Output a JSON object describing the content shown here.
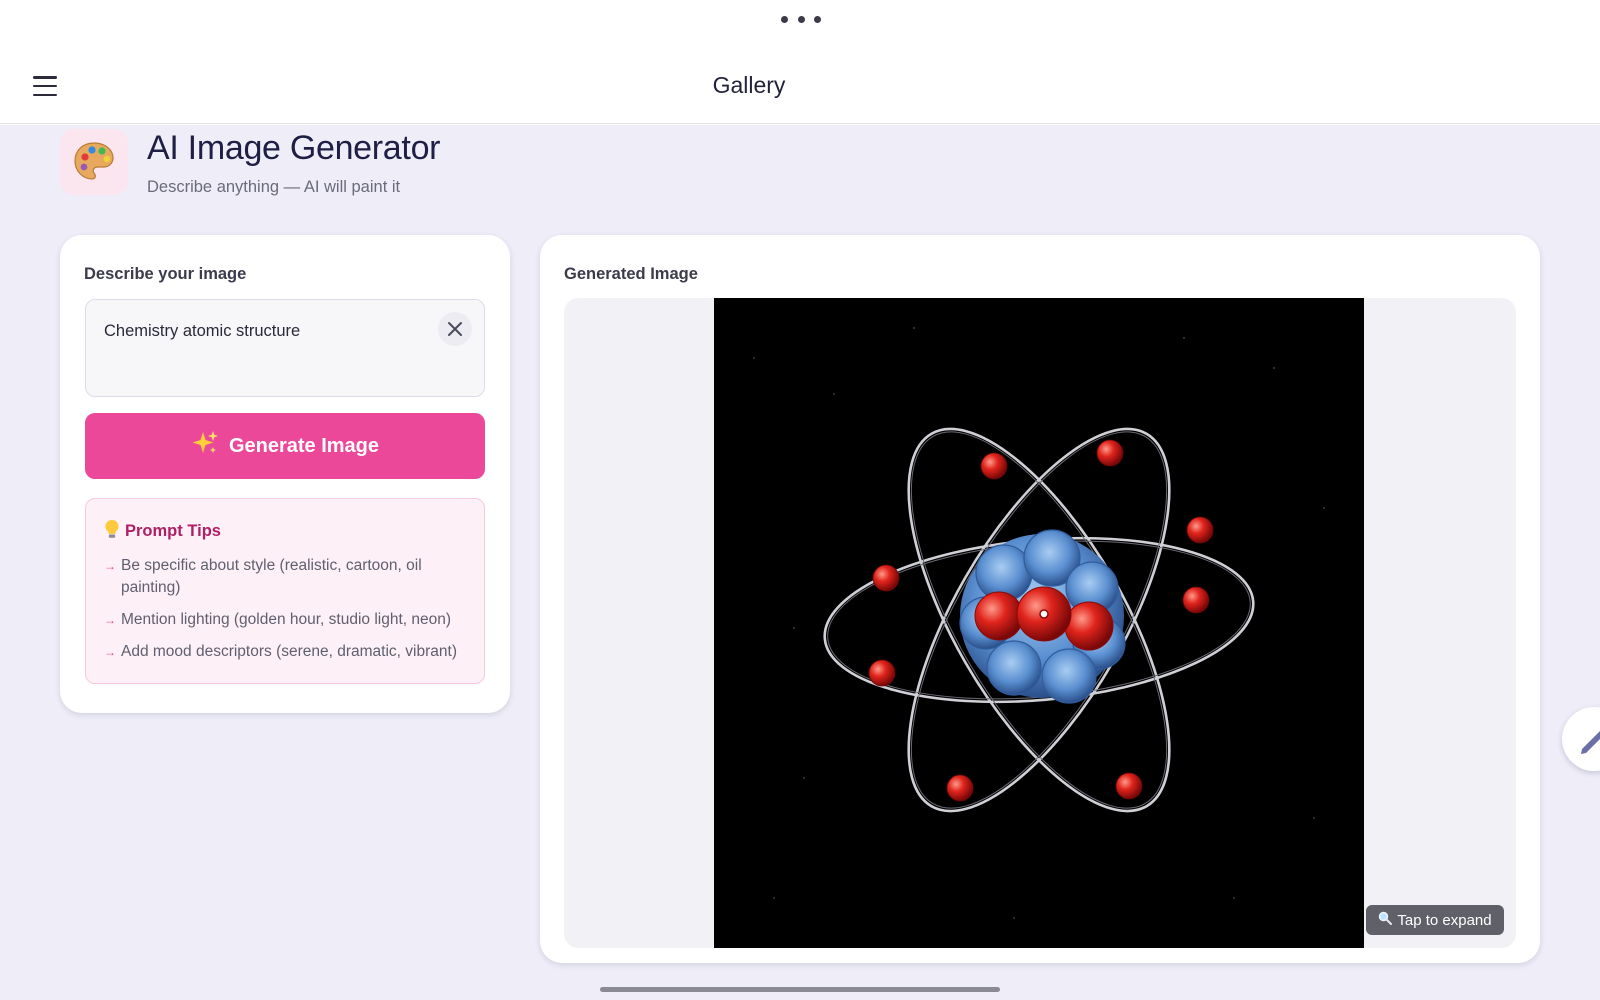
{
  "header": {
    "title": "Gallery",
    "menu_icon": "hamburger-menu-icon",
    "more_icon": "more-dots-icon"
  },
  "page": {
    "icon": "palette-icon",
    "title": "AI Image Generator",
    "subtitle": "Describe anything — AI will paint it"
  },
  "prompt_panel": {
    "label": "Describe your image",
    "prompt_value": "Chemistry atomic structure",
    "clear_icon": "close-icon",
    "generate_icon": "sparkles-icon",
    "generate_label": "Generate Image",
    "tips": {
      "icon": "lightbulb-icon",
      "title": "Prompt Tips",
      "items": [
        "Be specific about style (realistic, cartoon, oil painting)",
        "Mention lighting (golden hour, studio light, neon)",
        "Add mood descriptors (serene, dramatic, vibrant)"
      ]
    }
  },
  "result_panel": {
    "label": "Generated Image",
    "image_subject": "atom-model-image",
    "expand_icon": "magnifier-icon",
    "expand_label": "Tap to expand"
  },
  "fab_icon": "pencil-icon",
  "colors": {
    "accent": "#ec4899",
    "tips_title": "#b01f64",
    "background": "#eeedf8"
  }
}
